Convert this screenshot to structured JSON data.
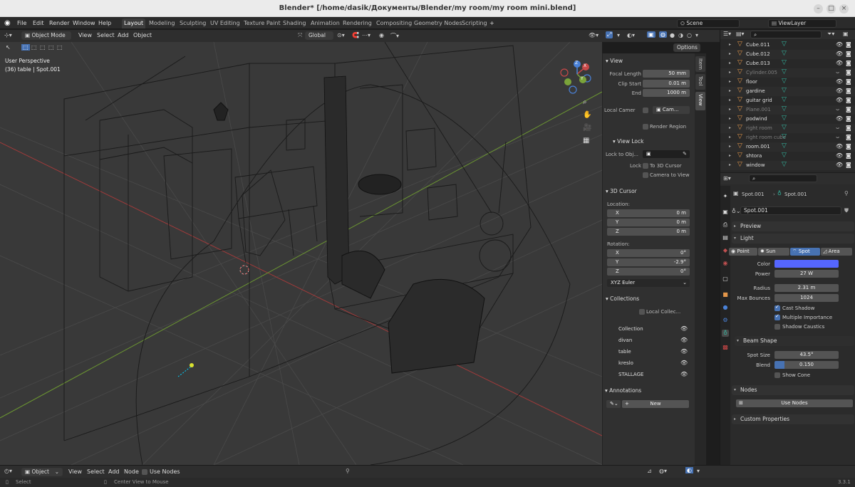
{
  "window": {
    "title": "Blender* [/home/dasik/Документы/Blender/my room/my room mini.blend]",
    "min_icon": "minimize-icon",
    "max_icon": "maximize-icon",
    "close_icon": "close-icon"
  },
  "menubar": {
    "menus": [
      "File",
      "Edit",
      "Render",
      "Window",
      "Help"
    ],
    "workspaces": [
      "Layout",
      "Modeling",
      "Sculpting",
      "UV Editing",
      "Texture Paint",
      "Shading",
      "Animation",
      "Rendering",
      "Compositing",
      "Geometry Nodes",
      "Scripting"
    ],
    "active_workspace": "Layout",
    "add_workspace": "+",
    "scene": "Scene",
    "view_layer": "ViewLayer"
  },
  "viewport_header": {
    "mode": "Object Mode",
    "menus": [
      "View",
      "Select",
      "Add",
      "Object"
    ],
    "transform_orientation": "Global",
    "options": "Options"
  },
  "viewport": {
    "perspective": "User Perspective",
    "info": "(36) table | Spot.001",
    "gizmo_axes": [
      "X",
      "Y",
      "Z"
    ]
  },
  "npanel": {
    "tabs": [
      "Item",
      "Tool",
      "View"
    ],
    "active_tab": "View",
    "view": {
      "header": "View",
      "focal_length_label": "Focal Length",
      "focal_length": "50 mm",
      "clip_start_label": "Clip Start",
      "clip_start": "0.01 m",
      "end_label": "End",
      "end": "1000 m",
      "local_camera_label": "Local Camer",
      "local_camera_value": "Cam...",
      "render_region": "Render Region"
    },
    "view_lock": {
      "header": "View Lock",
      "lock_to_object_label": "Lock to Obj...",
      "lock_label": "Lock",
      "to_3d_cursor": "To 3D Cursor",
      "camera_to_view": "Camera to View"
    },
    "cursor": {
      "header": "3D Cursor",
      "location_label": "Location:",
      "location": [
        {
          "axis": "X",
          "value": "0 m"
        },
        {
          "axis": "Y",
          "value": "0 m"
        },
        {
          "axis": "Z",
          "value": "0 m"
        }
      ],
      "rotation_label": "Rotation:",
      "rotation": [
        {
          "axis": "X",
          "value": "0°"
        },
        {
          "axis": "Y",
          "value": "-2.9°"
        },
        {
          "axis": "Z",
          "value": "0°"
        }
      ],
      "rotation_mode": "XYZ Euler"
    },
    "collections": {
      "header": "Collections",
      "local_collections": "Local Collec...",
      "items": [
        "Collection",
        "divan",
        "table",
        "kreslo",
        "STALLAGE"
      ]
    },
    "annotations": {
      "header": "Annotations",
      "add": "+",
      "new": "New"
    }
  },
  "outliner": {
    "search_placeholder": "",
    "items": [
      {
        "name": "Cube.011",
        "dim": false
      },
      {
        "name": "Cube.012",
        "dim": false
      },
      {
        "name": "Cube.013",
        "dim": false
      },
      {
        "name": "Cylinder.005",
        "dim": true
      },
      {
        "name": "floor",
        "dim": false
      },
      {
        "name": "gardine",
        "dim": false
      },
      {
        "name": "guitar grid",
        "dim": false
      },
      {
        "name": "Plane.001",
        "dim": true
      },
      {
        "name": "podwind",
        "dim": false
      },
      {
        "name": "right room",
        "dim": true
      },
      {
        "name": "right room cube",
        "dim": true
      },
      {
        "name": "room.001",
        "dim": false
      },
      {
        "name": "shtora",
        "dim": false
      },
      {
        "name": "window",
        "dim": false
      }
    ]
  },
  "properties": {
    "breadcrumb_object": "Spot.001",
    "breadcrumb_data": "Spot.001",
    "datablock": "Spot.001",
    "preview": "Preview",
    "light": "Light",
    "light_types": [
      "Point",
      "Sun",
      "Spot",
      "Area"
    ],
    "active_light_type": "Spot",
    "color_label": "Color",
    "color": "#5566ff",
    "power_label": "Power",
    "power": "27 W",
    "radius_label": "Radius",
    "radius": "2.31 m",
    "max_bounces_label": "Max Bounces",
    "max_bounces": "1024",
    "cast_shadow": "Cast Shadow",
    "multiple_importance": "Multiple Importance",
    "shadow_caustics": "Shadow Caustics",
    "beam_shape": "Beam Shape",
    "spot_size_label": "Spot Size",
    "spot_size": "43.5°",
    "blend_label": "Blend",
    "blend": "0.150",
    "blend_fraction": 0.15,
    "show_cone": "Show Cone",
    "nodes": "Nodes",
    "use_nodes": "Use Nodes",
    "custom_properties": "Custom Properties"
  },
  "footer": {
    "mode": "Object",
    "menus": [
      "View",
      "Select",
      "Add",
      "Node"
    ],
    "use_nodes": "Use Nodes"
  },
  "status": {
    "select": "Select",
    "center_view": "Center View to Mouse",
    "version": "3.3.1"
  },
  "colors": {
    "accent": "#4772b3",
    "axis_x": "#c74848",
    "axis_y": "#7aa33a",
    "axis_z": "#4a82d8",
    "object_orange": "#e3964a",
    "modifier_teal": "#33b6a0"
  }
}
